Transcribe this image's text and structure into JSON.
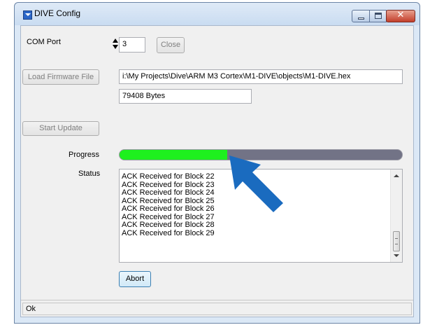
{
  "window": {
    "title": "DIVE Config"
  },
  "com_port": {
    "label": "COM Port",
    "value": "3",
    "close_label": "Close"
  },
  "firmware": {
    "load_label": "Load Firmware File",
    "path": "i:\\My Projects\\Dive\\ARM M3 Cortex\\M1-DIVE\\objects\\M1-DIVE.hex",
    "size": "79408 Bytes"
  },
  "update": {
    "start_label": "Start Update"
  },
  "progress": {
    "label": "Progress",
    "fraction": 0.38
  },
  "status": {
    "label": "Status",
    "items": [
      "ACK Received for Block 22",
      "ACK Received for Block 23",
      "ACK Received for Block 24",
      "ACK Received for Block 25",
      "ACK Received for Block 26",
      "ACK Received for Block 27",
      "ACK Received for Block 28",
      "ACK Received for Block 29"
    ]
  },
  "abort": {
    "label": "Abort"
  },
  "statusbar": {
    "text": "Ok"
  },
  "colors": {
    "progress_fill": "#1ef01e",
    "progress_track": "#727386",
    "annotation_arrow": "#1a6bbf"
  }
}
